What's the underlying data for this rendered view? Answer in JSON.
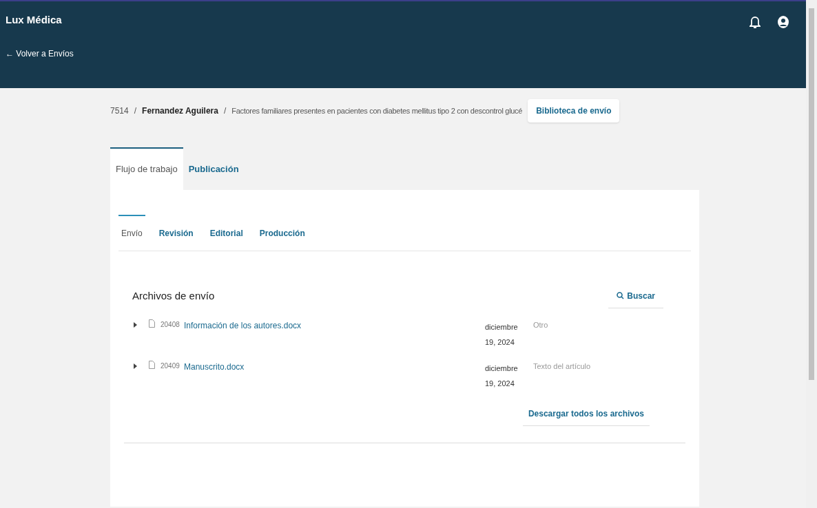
{
  "header": {
    "title": "Lux Médica",
    "back_link": "← Volver a Envíos"
  },
  "breadcrumb": {
    "id": "7514",
    "separators": [
      "/",
      "/"
    ],
    "author": "Fernandez Aguilera",
    "title": "Factores familiares presentes en pacientes con diabetes mellitus tipo 2 con descontrol glucé",
    "library_button": "Biblioteca de envío"
  },
  "tabs": [
    {
      "label": "Flujo de trabajo",
      "selected": true
    },
    {
      "label": "Publicación",
      "selected": false
    }
  ],
  "subtabs": [
    {
      "label": "Envío",
      "selected": true
    },
    {
      "label": "Revisión",
      "selected": false
    },
    {
      "label": "Editorial",
      "selected": false
    },
    {
      "label": "Producción",
      "selected": false
    }
  ],
  "files_section": {
    "title": "Archivos de envío",
    "search_button": "Buscar",
    "files": [
      {
        "id": "20408",
        "name": "Información de los autores.docx",
        "date": "diciembre 19, 2024",
        "type": "Otro",
        "expanded": false
      },
      {
        "id": "20409",
        "name": "Manuscrito.docx",
        "date": "diciembre 19, 2024",
        "type": "Texto del artículo",
        "expanded": false
      }
    ],
    "download_all": "Descargar todos los archivos"
  }
}
